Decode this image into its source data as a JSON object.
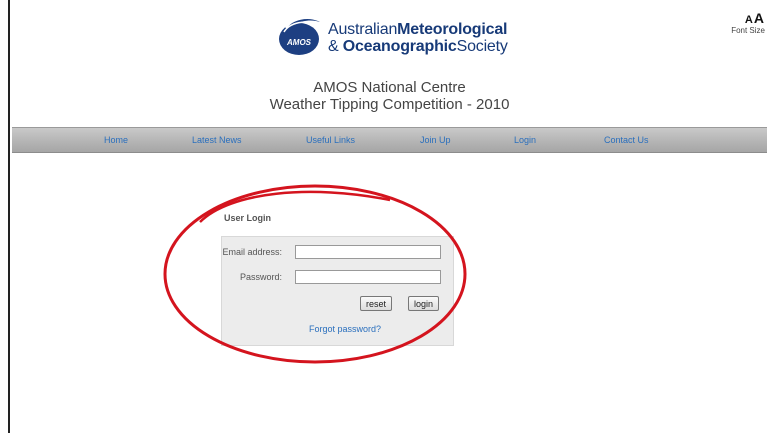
{
  "header": {
    "logo_line1_light": "Australian",
    "logo_line1_bold": "Meteorological",
    "logo_line2_light_a": "& ",
    "logo_line2_bold": "Oceanographic",
    "logo_line2_light_b": "Society",
    "logo_emblem_text": "AMOS",
    "title_line1": "AMOS National Centre",
    "title_line2": "Weather Tipping Competition - 2010"
  },
  "font_size_control": {
    "icon_small": "A",
    "icon_large": "A",
    "label": "Font Size"
  },
  "nav": {
    "items": [
      {
        "label": "Home"
      },
      {
        "label": "Latest News"
      },
      {
        "label": "Useful Links"
      },
      {
        "label": "Join Up"
      },
      {
        "label": "Login"
      },
      {
        "label": "Contact Us"
      }
    ]
  },
  "login": {
    "heading": "User Login",
    "email_label": "Email address:",
    "email_value": "",
    "password_label": "Password:",
    "password_value": "",
    "reset_label": "reset",
    "login_label": "login",
    "forgot_label": "Forgot password?"
  },
  "colors": {
    "brand_navy": "#173a78",
    "link_blue": "#2a6fbd",
    "annotation_red": "#d4141e",
    "nav_gray": "#b3b3b3"
  }
}
